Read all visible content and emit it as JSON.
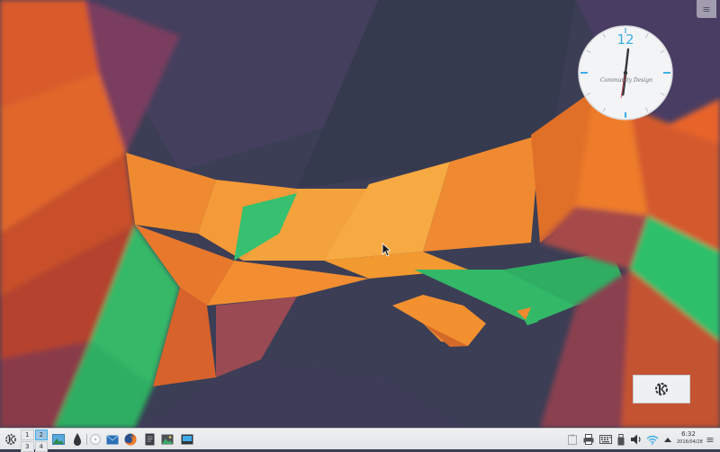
{
  "desktop": {
    "wallpaper": "kde-plasma-5-low-poly",
    "colors": {
      "base": "#3a3d52",
      "orange": "#f07a26",
      "green": "#2fbf6b",
      "purple": "#6a4d78",
      "accent": "#3daee9"
    }
  },
  "toolbox_icon": "hamburger-menu-icon",
  "toolbox_label": "≡",
  "clock": {
    "numeral": "12",
    "brand": "Community Design",
    "time": "6:32"
  },
  "taskbar": {
    "launcher_icon": "kde-logo-icon",
    "pager": [
      "1",
      "2",
      "3",
      "4"
    ],
    "pager_active": "2",
    "tasks": [
      {
        "icon": "image-viewer-icon"
      },
      {
        "icon": "krita-icon"
      },
      {
        "icon": "disc-icon"
      },
      {
        "icon": "mail-client-icon"
      },
      {
        "icon": "firefox-icon"
      },
      {
        "icon": "document-icon"
      },
      {
        "icon": "image-app-icon"
      },
      {
        "icon": "screenshot-app-icon"
      }
    ],
    "tray": [
      {
        "icon": "clipboard-icon"
      },
      {
        "icon": "printer-icon"
      },
      {
        "icon": "keyboard-icon"
      },
      {
        "icon": "usb-drive-icon"
      },
      {
        "icon": "volume-icon"
      },
      {
        "icon": "wifi-icon"
      },
      {
        "icon": "expand-tray-icon"
      }
    ],
    "time": "6:32",
    "date": "2016/04/28",
    "menu_label": "≡"
  }
}
